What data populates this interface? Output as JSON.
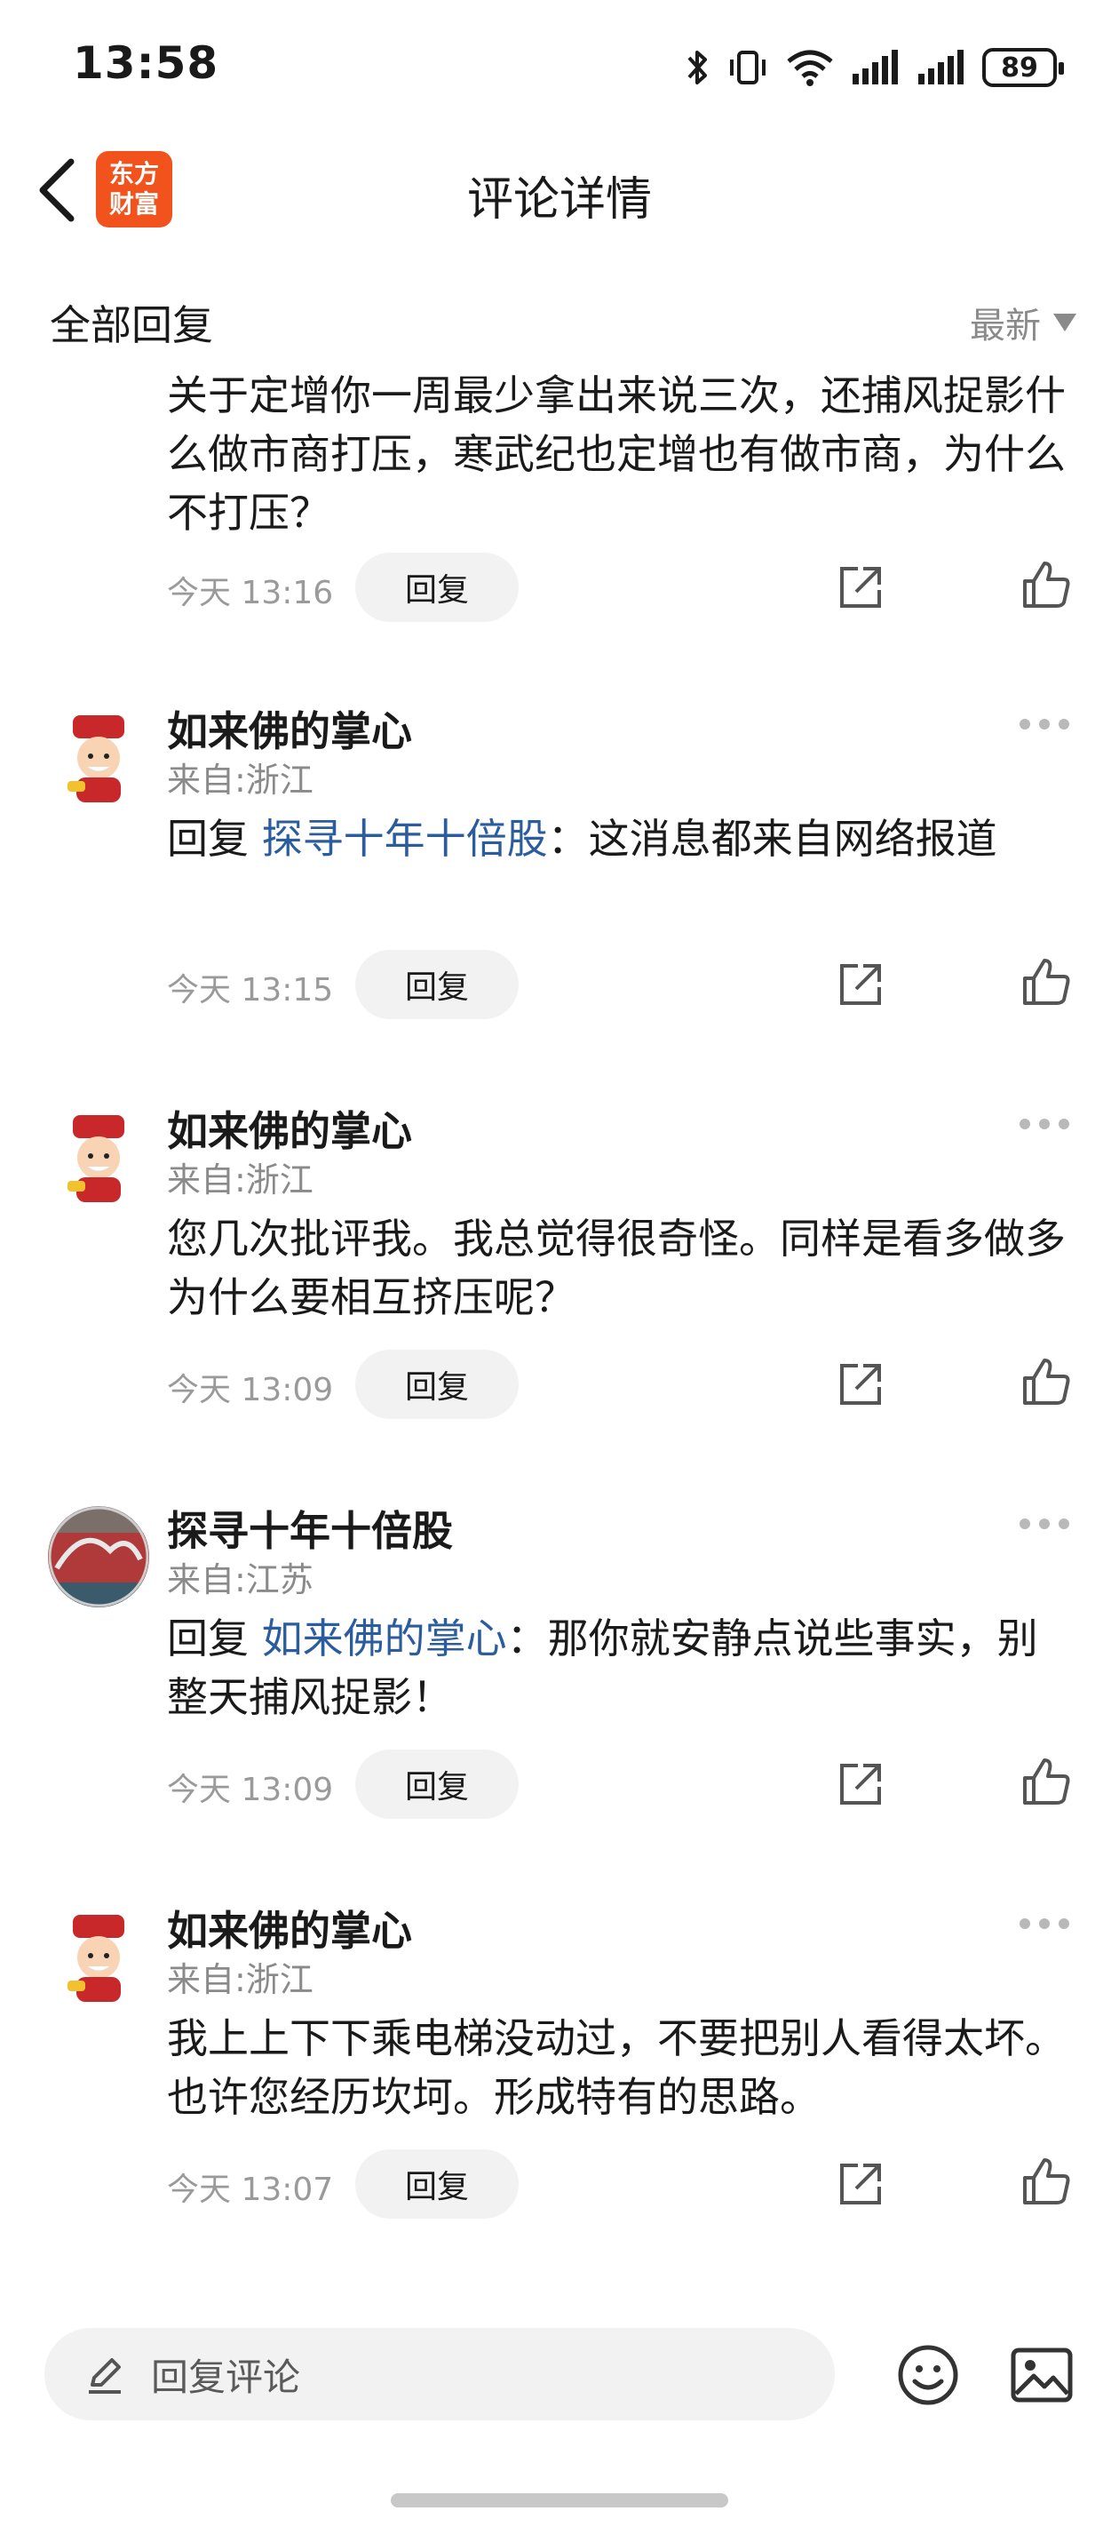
{
  "status_bar": {
    "time": "13:58",
    "battery": "89"
  },
  "nav": {
    "title": "评论详情",
    "logo_line1": "东方",
    "logo_line2": "财富"
  },
  "list_header": {
    "label": "全部回复",
    "sort": "最新"
  },
  "comments": [
    {
      "text": "关于定增你一周最少拿出来说三次，还捕风捉影什么做市商打压，寒武纪也定增也有做市商，为什么不打压？",
      "time": "今天 13:16",
      "reply_label": "回复"
    },
    {
      "author": "如来佛的掌心",
      "location": "来自:浙江",
      "reply_prefix": "回复",
      "reply_to": "探寻十年十倍股",
      "text": "：这消息都来自网络报道",
      "time": "今天 13:15",
      "reply_label": "回复"
    },
    {
      "author": "如来佛的掌心",
      "location": "来自:浙江",
      "text": "您几次批评我。我总觉得很奇怪。同样是看多做多为什么要相互挤压呢？",
      "time": "今天 13:09",
      "reply_label": "回复"
    },
    {
      "author": "探寻十年十倍股",
      "location": "来自:江苏",
      "reply_prefix": "回复",
      "reply_to": "如来佛的掌心",
      "text": "：那你就安静点说些事实，别整天捕风捉影！",
      "time": "今天 13:09",
      "reply_label": "回复"
    },
    {
      "author": "如来佛的掌心",
      "location": "来自:浙江",
      "text": "我上上下下乘电梯没动过，不要把别人看得太坏。也许您经历坎坷。形成特有的思路。",
      "time": "今天 13:07",
      "reply_label": "回复"
    }
  ],
  "bottom_bar": {
    "placeholder": "回复评论"
  },
  "colors": {
    "link": "#2b5d9e",
    "brand": "#f2531c"
  },
  "icons": [
    "back-arrow-icon",
    "bluetooth-icon",
    "vibrate-icon",
    "wifi-icon",
    "signal-icon",
    "share-icon",
    "thumbs-up-icon",
    "more-icon",
    "pen-icon",
    "emoji-icon",
    "image-icon"
  ]
}
